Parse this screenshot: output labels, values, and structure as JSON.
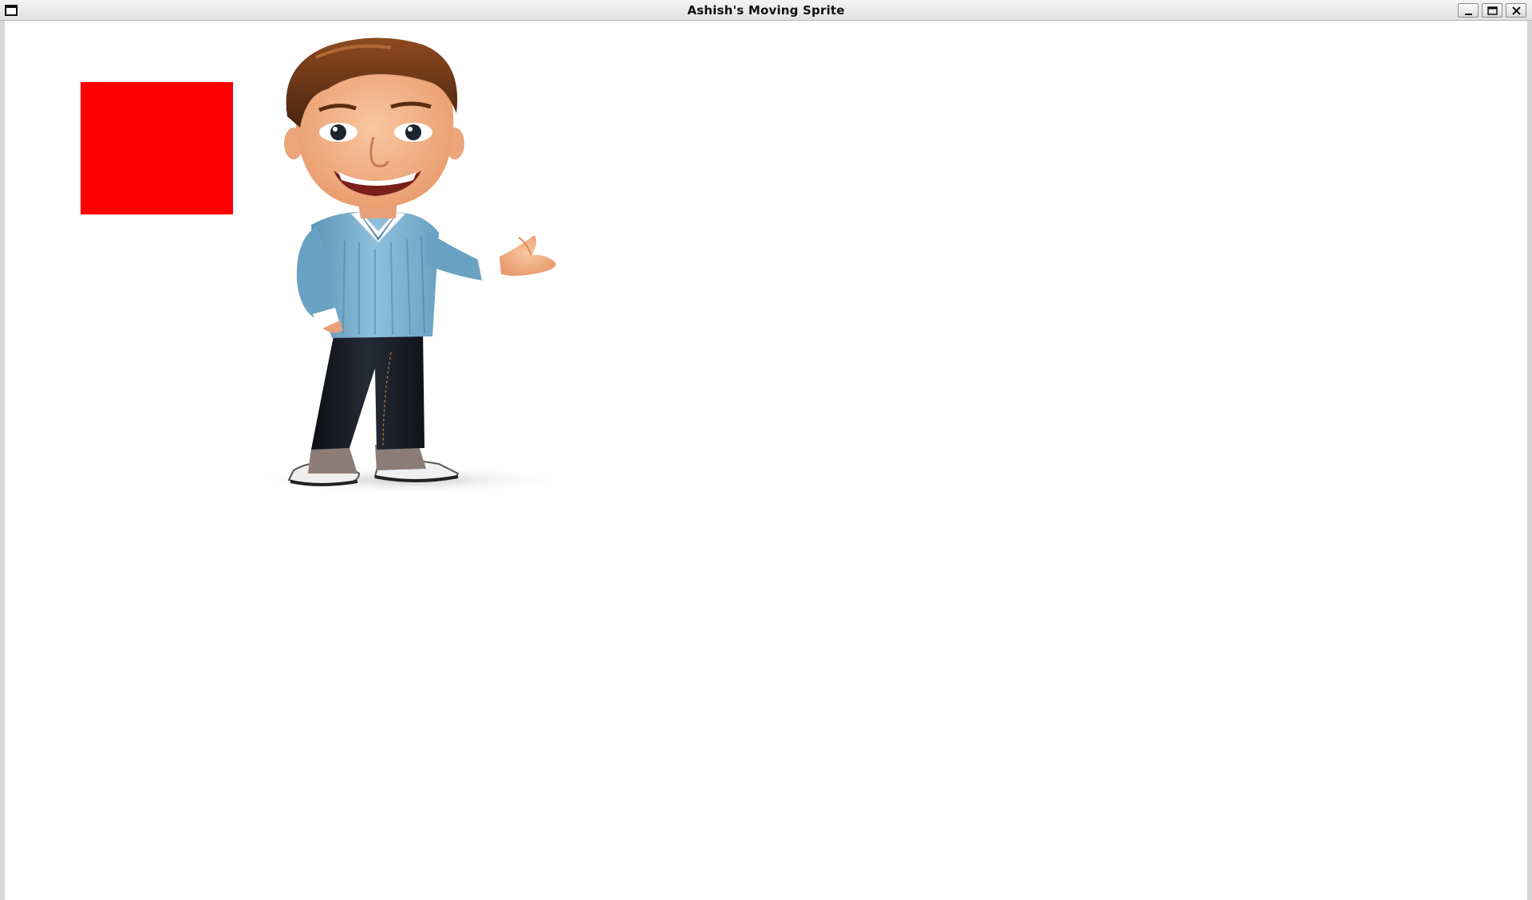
{
  "window": {
    "title": "Ashish's Moving Sprite",
    "icons": {
      "app": "window-app-icon",
      "minimize": "minimize-icon",
      "maximize": "maximize-icon",
      "close": "close-icon"
    }
  },
  "scene": {
    "background": "#ffffff",
    "rect_color": "#ff0000",
    "sprite": "cartoon-man-sprite"
  }
}
